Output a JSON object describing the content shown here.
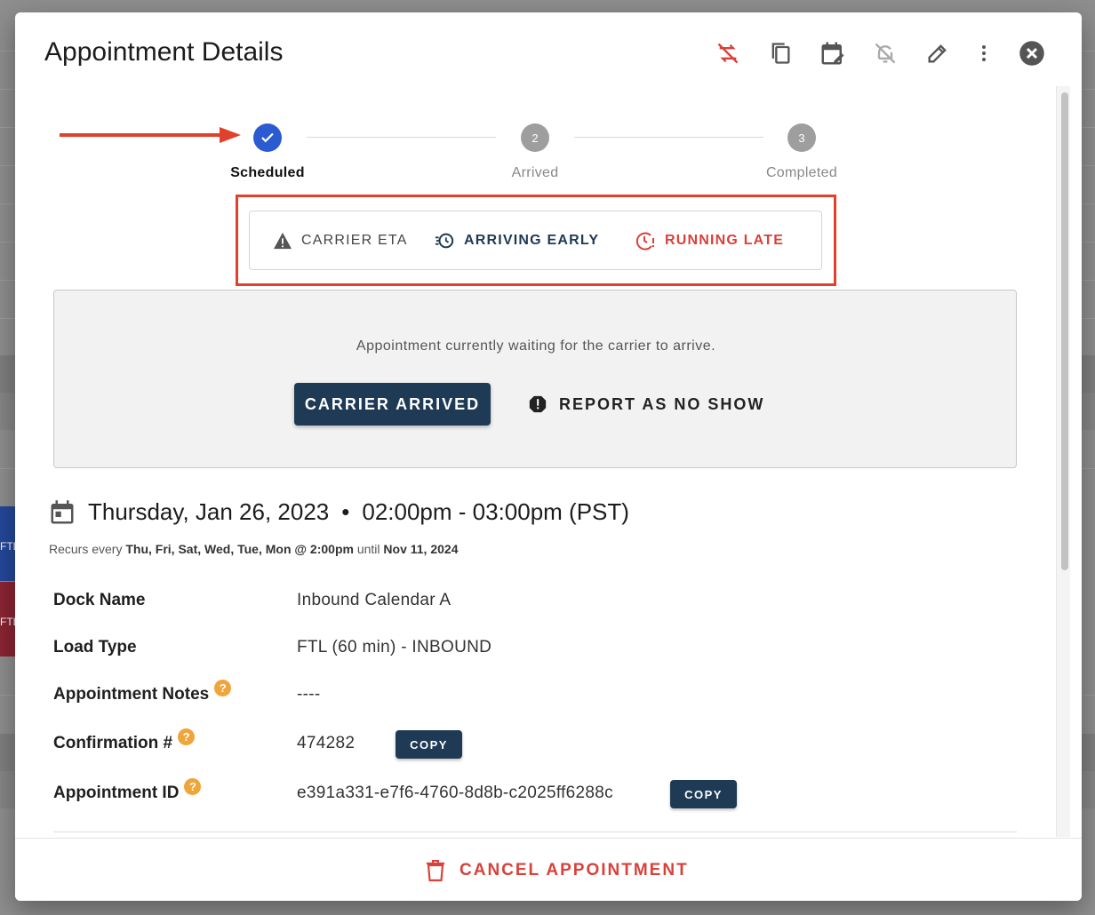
{
  "modal": {
    "title": "Appointment Details"
  },
  "toolbar": {
    "icons": [
      "unlink-recurrence-icon",
      "copy-icon",
      "calendar-edit-icon",
      "notifications-off-icon",
      "edit-icon",
      "more-vert-icon",
      "close-icon"
    ]
  },
  "stepper": {
    "steps": [
      {
        "number": "1",
        "label": "Scheduled",
        "state": "complete"
      },
      {
        "number": "2",
        "label": "Arrived",
        "state": "pending"
      },
      {
        "number": "3",
        "label": "Completed",
        "state": "pending"
      }
    ]
  },
  "eta": {
    "carrier_eta": "CARRIER ETA",
    "arriving_early": "ARRIVING EARLY",
    "running_late": "RUNNING LATE"
  },
  "status": {
    "message": "Appointment currently waiting for the carrier to arrive.",
    "primary_action": "CARRIER ARRIVED",
    "secondary_action": "REPORT AS NO SHOW"
  },
  "schedule": {
    "date": "Thursday, Jan 26, 2023",
    "separator": "•",
    "time": "02:00pm - 03:00pm (PST)",
    "recur_prefix": "Recurs every",
    "recur_days": "Thu, Fri, Sat, Wed, Tue, Mon @ 2:00pm",
    "recur_until_word": "until",
    "recur_until": "Nov 11, 2024"
  },
  "details": {
    "dock_name_label": "Dock Name",
    "dock_name_value": "Inbound Calendar A",
    "load_type_label": "Load Type",
    "load_type_value": "FTL (60 min) - INBOUND",
    "notes_label": "Appointment Notes",
    "notes_value": "----",
    "confirmation_label": "Confirmation #",
    "confirmation_value": "474282",
    "appointment_id_label": "Appointment ID",
    "appointment_id_value": "e391a331-e7f6-4760-8d8b-c2025ff6288c",
    "copy_label": "COPY",
    "help_glyph": "?"
  },
  "footer": {
    "cancel_label": "CANCEL APPOINTMENT"
  },
  "background": {
    "event_1": "FTL",
    "event_2": "FTL"
  },
  "colors": {
    "primary": "#1e3a55",
    "step_active": "#2b5bd1",
    "step_inactive": "#9e9e9e",
    "danger": "#d9413a",
    "annotation": "#e0412a",
    "help": "#f0a53a"
  }
}
